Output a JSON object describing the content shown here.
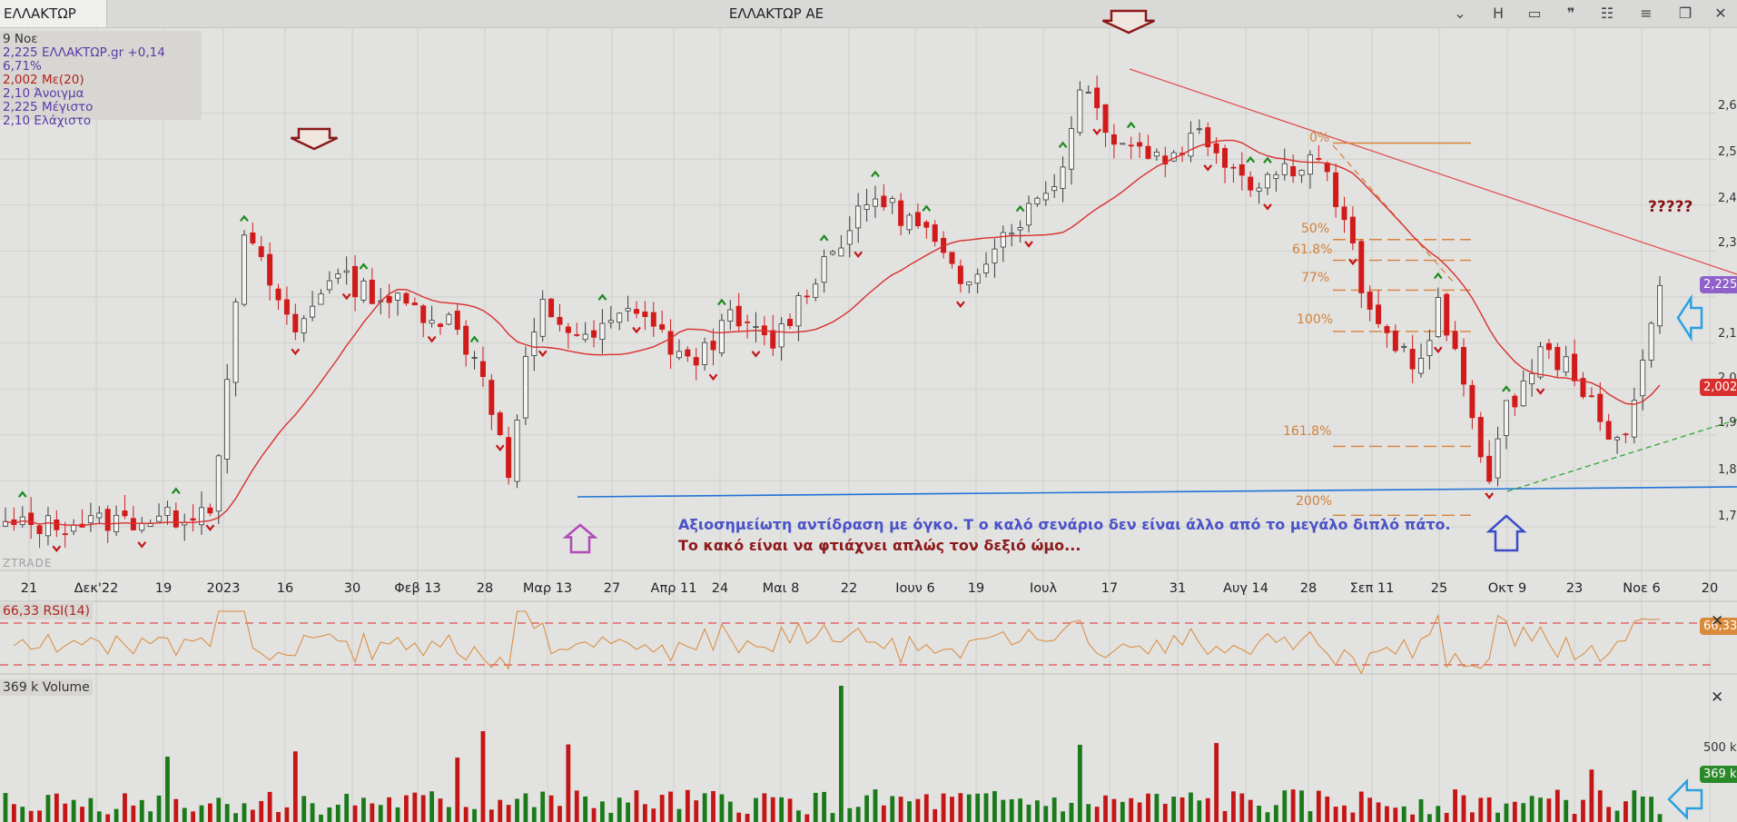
{
  "header": {
    "symbol_tab": "ΕΛΛΑΚΤΩΡ",
    "chart_title": "ΕΛΛΑΚΤΩΡ ΑΕ",
    "toolbar": [
      {
        "name": "dropdown-chevron-icon",
        "glyph": "⌄"
      },
      {
        "name": "h-button",
        "glyph": "H"
      },
      {
        "name": "window-icon",
        "glyph": "▭"
      },
      {
        "name": "quote-icon",
        "glyph": "❞"
      },
      {
        "name": "lock-icon",
        "glyph": "🔒"
      },
      {
        "name": "menu-icon",
        "glyph": "≡"
      },
      {
        "name": "restore-window-icon",
        "glyph": "❐"
      },
      {
        "name": "close-icon",
        "glyph": "✕"
      }
    ]
  },
  "info_panel": {
    "date": "9 Νοε",
    "price_line": "2,225 ΕΛΛΑΚΤΩΡ.gr +0,14 6,71%",
    "ma_line": "2,002 Με(20)",
    "open_line": "2,10 Άνοιγμα",
    "high_line": "2,225 Μέγιστο",
    "low_line": "2,10 Ελάχιστο"
  },
  "colors": {
    "up": "#f4f4f2",
    "down": "#d11a1a",
    "ma": "#d9302e",
    "blue": "#1f73d6",
    "volume_up": "#1a7a1a",
    "volume_down": "#c41616",
    "rsi": "#d98a3a"
  },
  "annotations": {
    "line1": "Αξιοσημείωτη αντίδραση με όγκο. Τ ο καλό σενάριο δεν είναι άλλο από το μεγάλο διπλό πάτο.",
    "line2": "Το κακό είναι να φτιάχνει απλώς τον δεξιό ώμο...",
    "question": "?????",
    "watermark": "ZTRADE"
  },
  "fib_labels": [
    {
      "label": "0%",
      "price": 2.535
    },
    {
      "label": "50%",
      "price": 2.325
    },
    {
      "label": "61.8%",
      "price": 2.28
    },
    {
      "label": "77%",
      "price": 2.215
    },
    {
      "label": "100%",
      "price": 2.125
    },
    {
      "label": "161.8%",
      "price": 1.875
    },
    {
      "label": "200%",
      "price": 1.725
    }
  ],
  "badges": {
    "price": "2,225",
    "ma": "2,002",
    "rsi": "66,33",
    "volume": "369 k"
  },
  "rsi_panel": {
    "label": "66,33 RSI(14)"
  },
  "volume_panel": {
    "label": "369 k Volume",
    "tick": "500 k"
  },
  "chart_data": {
    "type": "candlestick",
    "title": "ΕΛΛΑΚΤΩΡ ΑΕ",
    "x_ticks": [
      "21",
      "Δεκ'22",
      "19",
      "2023",
      "16",
      "30",
      "Φεβ 13",
      "28",
      "Μαρ 13",
      "27",
      "Απρ 11",
      "24",
      "Μαι 8",
      "22",
      "Ιουν 6",
      "19",
      "Ιουλ",
      "17",
      "31",
      "Αυγ 14",
      "28",
      "Σεπ 11",
      "25",
      "Οκτ 9",
      "23",
      "Νοε 6",
      "20"
    ],
    "y_ticks": [
      1.7,
      1.8,
      1.9,
      2.0,
      2.1,
      2.2,
      2.3,
      2.4,
      2.5,
      2.6
    ],
    "y_tick_labels": [
      "1,7",
      "1,8",
      "1,9",
      "2,0",
      "2,1",
      "2,2",
      "2,3",
      "2,4",
      "2,5",
      "2,6"
    ],
    "ylim": [
      1.64,
      2.67
    ],
    "anchors": [
      [
        0,
        1.7
      ],
      [
        20,
        1.72
      ],
      [
        24,
        1.75
      ],
      [
        26,
        2.0
      ],
      [
        28,
        2.34
      ],
      [
        34,
        2.12
      ],
      [
        38,
        2.25
      ],
      [
        44,
        2.2
      ],
      [
        52,
        2.15
      ],
      [
        56,
        2.04
      ],
      [
        59,
        1.81
      ],
      [
        61,
        2.05
      ],
      [
        63,
        2.18
      ],
      [
        68,
        2.1
      ],
      [
        74,
        2.18
      ],
      [
        80,
        2.05
      ],
      [
        85,
        2.15
      ],
      [
        90,
        2.1
      ],
      [
        96,
        2.28
      ],
      [
        102,
        2.42
      ],
      [
        108,
        2.34
      ],
      [
        112,
        2.22
      ],
      [
        116,
        2.32
      ],
      [
        120,
        2.39
      ],
      [
        124,
        2.48
      ],
      [
        126,
        2.67
      ],
      [
        130,
        2.55
      ],
      [
        136,
        2.5
      ],
      [
        140,
        2.56
      ],
      [
        146,
        2.45
      ],
      [
        150,
        2.48
      ],
      [
        154,
        2.51
      ],
      [
        158,
        2.3
      ],
      [
        160,
        2.15
      ],
      [
        163,
        2.1
      ],
      [
        166,
        2.05
      ],
      [
        168,
        2.18
      ],
      [
        172,
        1.95
      ],
      [
        174,
        1.8
      ],
      [
        176,
        1.95
      ],
      [
        180,
        2.08
      ],
      [
        184,
        2.04
      ],
      [
        188,
        1.88
      ],
      [
        190,
        1.92
      ],
      [
        194,
        2.2
      ]
    ],
    "volume_tick": "500 k",
    "rsi_label": "66,33 RSI(14)",
    "volume_label": "369 k Volume",
    "ma_label": "Με(20)"
  }
}
